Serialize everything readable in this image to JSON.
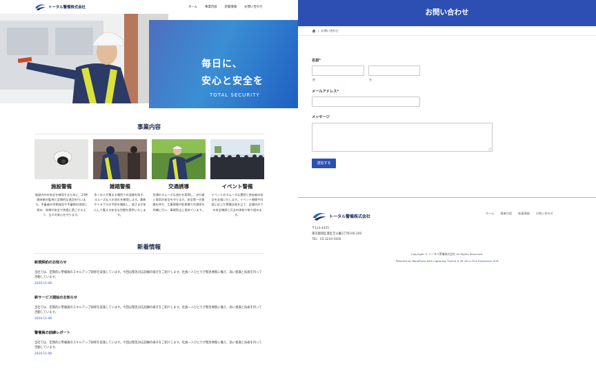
{
  "colors": {
    "brand_blue": "#2d4fb4",
    "navy": "#1d2b4f",
    "link_blue": "#2d55b3",
    "required_red": "#c92b2b"
  },
  "left": {
    "header": {
      "logo_icon": "company-wave-logo",
      "logo_text": "トータル警備株式会社",
      "nav": [
        "ホーム",
        "事業内容",
        "新着情報",
        "お問い合わせ"
      ]
    },
    "hero": {
      "line1": "毎日に、",
      "line2": "安心と安全を",
      "tagline": "TOTAL SECURITY"
    },
    "services": {
      "title": "事業内容",
      "items": [
        {
          "name": "施設警備",
          "desc": "施設内外の安全を確保するために、24時間体制の監視と定期的な巡回を行います。不審者の早期発見や不審物の排除に努め、皆様が安全で快適に過ごせるよう、日々の安心を守ります。"
        },
        {
          "name": "雑踏警備",
          "desc": "多くの人が集まる場所での混雑を防ぎ、スムーズな人の流れを確保します。事故やトラブルの予防を徹底し、皆さまが安心して集える安全な空間を提供いたします。"
        },
        {
          "name": "交通誘導",
          "desc": "交通のスムーズな流れを実現し、歩行者と車両の安全を守ります。安全第一の意識を持ち、工事現場や駐車場での誘導を的確に行い、事故防止に努めています。"
        },
        {
          "name": "イベント警備",
          "desc": "イベントのスムーズな運営と参加者の安全を支援いたします。イベント規模や内容に応じた警備計画を立て、会場内外での安全確保と万全の体制で取り組みます。"
        }
      ]
    },
    "news": {
      "title": "新着情報",
      "items": [
        {
          "title": "新規契約のお知らせ",
          "body": "当社では、定期的に警備員のスキルアップ研修を実施しています。今回は緊急対応訓練の様子をご紹介します。社員一人ひとりが緊急事態に備え、高い意識と技術を持って活動しています。",
          "date": "2024-11-08"
        },
        {
          "title": "新サービス開始のお知らせ",
          "body": "当社では、定期的に警備員のスキルアップ研修を実施しています。今回は緊急対応訓練の様子をご紹介します。社員一人ひとりが緊急事態に備え、高い意識と技術を持って活動しています。",
          "date": "2024-11-08"
        },
        {
          "title": "警備員の訓練レポート",
          "body": "当社では、定期的に警備員のスキルアップ研修を実施しています。今回は緊急対応訓練の様子をご紹介します。社員一人ひとりが緊急事態に備え、高い意識と技術を持って活動しています。",
          "date": "2024-11-08"
        }
      ]
    }
  },
  "right": {
    "page_title": "お問い合わせ",
    "breadcrumb": {
      "home_icon": "home-icon",
      "sep": "/",
      "current": "お問い合わせ"
    },
    "form": {
      "name_label": "名前",
      "required_mark": "*",
      "last_sub": "姓",
      "first_sub": "名",
      "email_label": "メールアドレス",
      "message_label": "メッセージ",
      "submit": "送信する"
    },
    "footer": {
      "logo_text": "トータル警備株式会社",
      "nav": [
        "ホーム",
        "事業内容",
        "新着情報",
        "お問い合わせ"
      ],
      "postal": "〒123-4455",
      "address": "東京都港区港区芝公園3丁目100-200",
      "tel": "TEL：03-3234-5926",
      "copyright": "Copyright © トータル警備株式会社 All Rights Reserved.",
      "powered_prefix": "Powered by",
      "powered_wp": "WordPress",
      "powered_with": "with",
      "powered_theme": "Lightning Theme & VK All in One Expansion Unit"
    }
  }
}
